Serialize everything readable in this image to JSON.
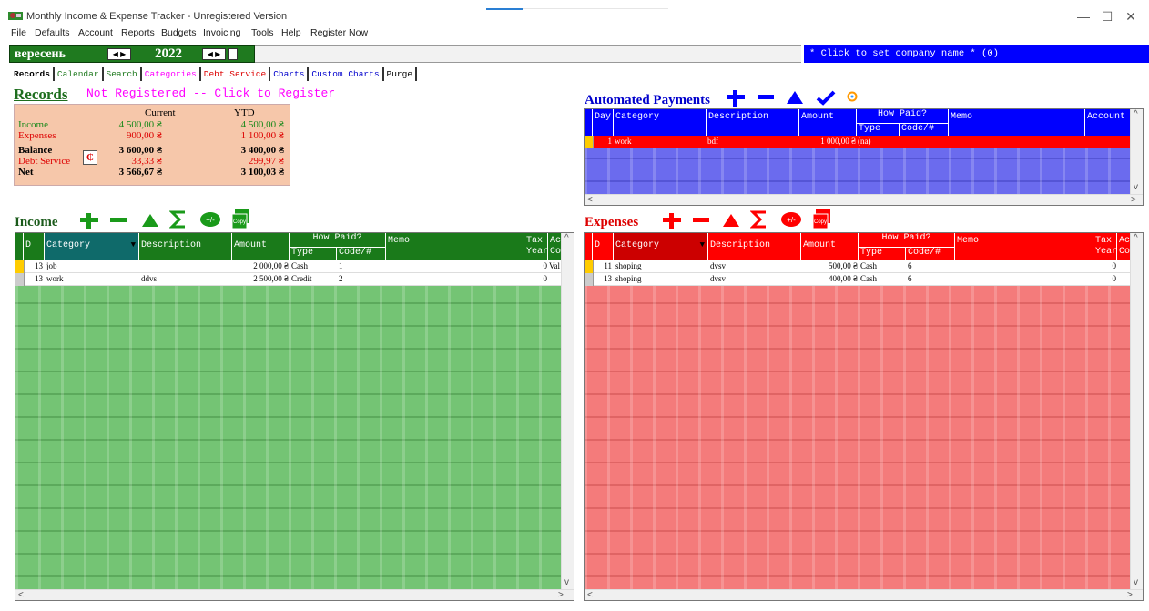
{
  "window": {
    "title": "Monthly Income & Expense Tracker - Unregistered Version",
    "minimize": "—",
    "maximize": "☐",
    "close": "✕"
  },
  "menu": [
    "File",
    "Defaults",
    "Account",
    "Reports",
    "Budgets",
    "Invoicing",
    "Tools",
    "Help",
    "Register Now"
  ],
  "period": {
    "month": "вересень",
    "year": "2022"
  },
  "company": "* Click to set company name * (0)",
  "tabs": [
    "Records",
    "Calendar",
    "Search",
    "Categories",
    "Debt Service",
    "Charts",
    "Custom Charts",
    "Purge"
  ],
  "tab_colors": [
    "#000000",
    "#1f7a1f",
    "#1f7a1f",
    "#ff00ff",
    "#dd0000",
    "#0000cc",
    "#0000cc",
    "#000000"
  ],
  "records": {
    "title": "Records",
    "not_registered": "Not Registered -- Click to Register",
    "col_current": "Current",
    "col_ytd": "YTD",
    "income_label": "Income",
    "income_current": "4 500,00 ₴",
    "income_ytd": "4 500,00 ₴",
    "expenses_label": "Expenses",
    "expenses_current": "900,00 ₴",
    "expenses_ytd": "1 100,00 ₴",
    "balance_label": "Balance",
    "balance_current": "3 600,00 ₴",
    "balance_ytd": "3 400,00 ₴",
    "debt_label": "Debt Service",
    "debt_current": "33,33 ₴",
    "debt_ytd": "299,97 ₴",
    "net_label": "Net",
    "net_current": "3 566,67 ₴",
    "net_ytd": "3 100,03 ₴"
  },
  "automated": {
    "title": "Automated Payments",
    "headers": {
      "day": "Day",
      "category": "Category",
      "description": "Description",
      "amount": "Amount",
      "how_paid": "How Paid?",
      "type": "Type",
      "code": "Code/#",
      "memo": "Memo",
      "account": "Account"
    },
    "rows": [
      {
        "day": "1",
        "category": "work",
        "description": "bdf",
        "amount": "1 000,00 ₴",
        "type": "(na)"
      }
    ]
  },
  "income": {
    "title": "Income",
    "headers": {
      "d": "D",
      "category": "Category",
      "description": "Description",
      "amount": "Amount",
      "how_paid": "How Paid?",
      "type": "Type",
      "code": "Code/#",
      "memo": "Memo",
      "tax": "Tax",
      "year": "Year",
      "ac": "Ac",
      "co": "Co"
    },
    "rows": [
      {
        "d": "13",
        "category": "job",
        "description": "",
        "amount": "2 000,00 ₴",
        "type": "Cash",
        "code": "1",
        "tax": "0",
        "extra": "Val"
      },
      {
        "d": "13",
        "category": "work",
        "description": "ddvs",
        "amount": "2 500,00 ₴",
        "type": "Credit",
        "code": "2",
        "tax": "0",
        "extra": ""
      }
    ]
  },
  "expenses": {
    "title": "Expenses",
    "headers": {
      "d": "D",
      "category": "Category",
      "description": "Description",
      "amount": "Amount",
      "how_paid": "How Paid?",
      "type": "Type",
      "code": "Code/#",
      "memo": "Memo",
      "tax": "Tax",
      "year": "Year",
      "ac": "Ac",
      "co": "Co"
    },
    "rows": [
      {
        "d": "11",
        "category": "shoping",
        "description": "dvsv",
        "amount": "500,00 ₴",
        "type": "Cash",
        "code": "6",
        "tax": "0"
      },
      {
        "d": "13",
        "category": "shoping",
        "description": "dvsv",
        "amount": "400,00 ₴",
        "type": "Cash",
        "code": "6",
        "tax": "0"
      }
    ]
  },
  "toolbar": {
    "copy": "Copy",
    "plusminus": "+/-"
  },
  "colors": {
    "income_green": "#1a7a1a",
    "expense_red": "#ff0000",
    "auto_blue": "#0000ff",
    "company_blue": "#0000ff"
  }
}
